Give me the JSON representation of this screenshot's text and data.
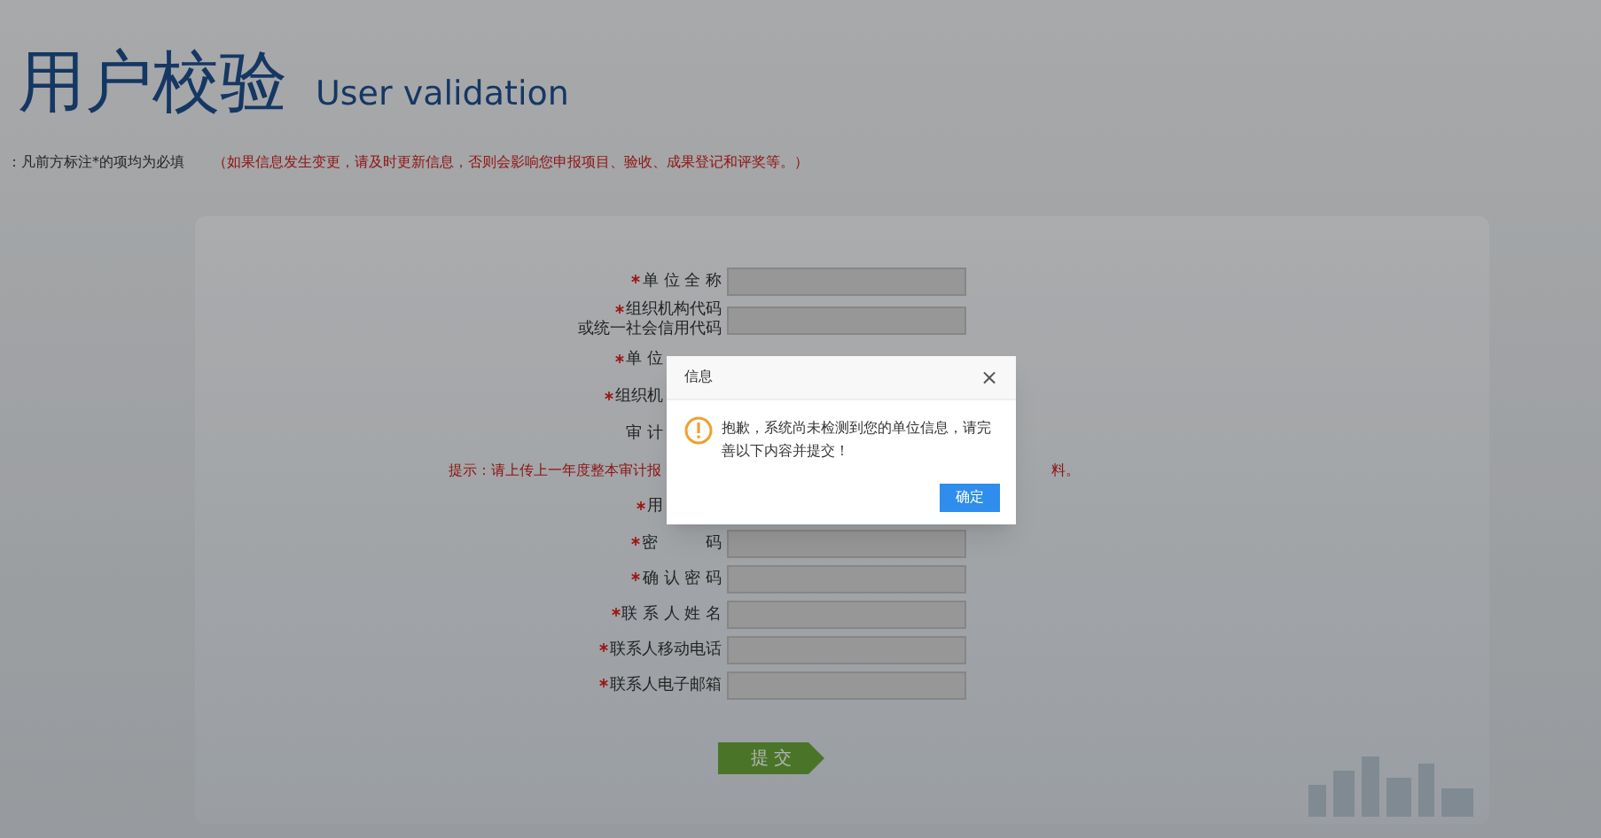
{
  "header": {
    "title": "用户校验",
    "subtitle": "User validation"
  },
  "notice": {
    "text": "：凡前方标注*的项均为必填",
    "warning": "（如果信息发生变更，请及时更新信息，否则会影响您申报项目、验收、成果登记和评奖等。）"
  },
  "form": {
    "rows": [
      {
        "kind": "input",
        "label": "单 位 全 称",
        "required": true
      },
      {
        "kind": "input",
        "label": "组织机构代码",
        "label_2": "或统一社会信用代码",
        "required": true
      },
      {
        "kind": "covered",
        "label": "单 位",
        "required": true
      },
      {
        "kind": "covered",
        "label": "组织机",
        "required": true
      },
      {
        "kind": "covered",
        "label": "审 计",
        "required": false
      },
      {
        "kind": "hint",
        "label": "提示：请上传上一年度整本审计报",
        "label_2": "料。"
      },
      {
        "kind": "covered",
        "label": "用",
        "required": true
      },
      {
        "kind": "input",
        "label": "密　　　码",
        "required": true
      },
      {
        "kind": "input",
        "label": "确 认 密 码",
        "required": true
      },
      {
        "kind": "input",
        "label": "联 系 人 姓 名",
        "required": true
      },
      {
        "kind": "input",
        "label": "联系人移动电话",
        "required": true
      },
      {
        "kind": "input",
        "label": "联系人电子邮箱",
        "required": true
      }
    ],
    "submit": "提 交"
  },
  "dialog": {
    "title": "信息",
    "close": "×",
    "message": "抱歉，系统尚未检测到您的单位信息，请完善以下内容并提交！",
    "button": "确定"
  }
}
